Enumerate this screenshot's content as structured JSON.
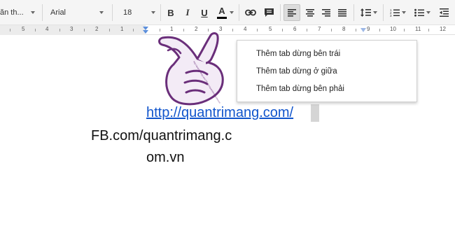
{
  "toolbar": {
    "style_dropdown": "ăn th...",
    "font_dropdown": "Arial",
    "size_dropdown": "18",
    "bold_label": "B",
    "italic_label": "I",
    "underline_label": "U",
    "text_color_label": "A"
  },
  "ruler": {
    "numbers": [
      "5",
      "4",
      "3",
      "2",
      "1",
      "1",
      "2",
      "3",
      "4",
      "5",
      "6",
      "7",
      "8",
      "9",
      "10",
      "11",
      "12"
    ]
  },
  "context_menu": {
    "items": [
      "Thêm tab dừng bên trái",
      "Thêm tab dừng ở giữa",
      "Thêm tab dừng bên phải"
    ]
  },
  "document": {
    "link_text": "http://quantrimang.com/",
    "line2": "FB.com/quantrimang.c",
    "line3": "om.vn"
  },
  "hand_watermark": {
    "text": "http://quantrimang.com/ FB.com/quantrimang.com.vn"
  },
  "colors": {
    "toolbar_bg": "#f5f5f5",
    "link": "#1155cc",
    "hand_outline": "#6a2e7a",
    "hand_fill": "#f3ebf6"
  }
}
